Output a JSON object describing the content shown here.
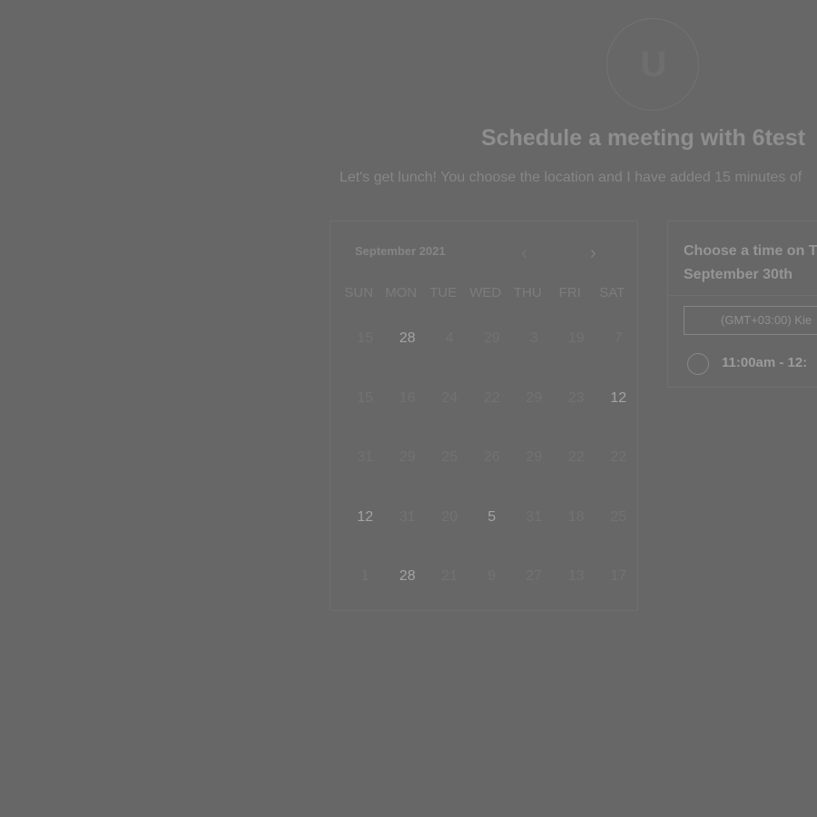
{
  "header": {
    "avatar_initial": "U",
    "title": "Schedule a meeting with 6test",
    "subtitle": "Let's get lunch! You choose the location and I have added 15 minutes of"
  },
  "calendar": {
    "month_label": "September 2021",
    "prev_icon": "chevron-left-icon",
    "next_icon": "chevron-right-icon",
    "weekdays": [
      "SUN",
      "MON",
      "TUE",
      "WED",
      "THU",
      "FRI",
      "SAT"
    ],
    "weeks": [
      [
        "15",
        "28",
        "4",
        "29",
        "3",
        "19",
        "7"
      ],
      [
        "15",
        "16",
        "24",
        "22",
        "29",
        "23",
        "12"
      ],
      [
        "31",
        "29",
        "25",
        "26",
        "29",
        "22",
        "22"
      ],
      [
        "12",
        "31",
        "20",
        "5",
        "31",
        "18",
        "25"
      ],
      [
        "1",
        "28",
        "21",
        "9",
        "27",
        "13",
        "17"
      ]
    ]
  },
  "times": {
    "heading_line1": "Choose a time on T",
    "heading_line2": "September 30th",
    "timezone": "(GMT+03:00) Kie",
    "slot": "11:00am - 12:"
  },
  "colors": {
    "overlay_background": "#676767"
  }
}
